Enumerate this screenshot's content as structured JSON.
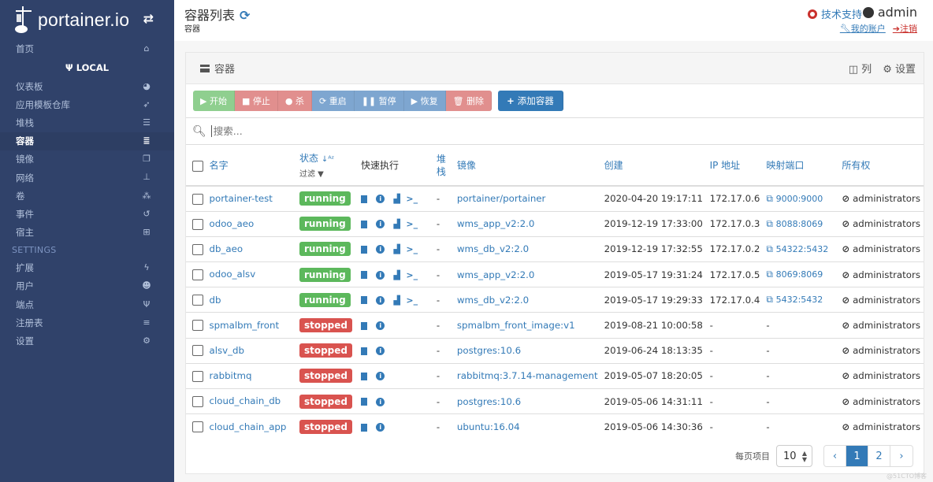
{
  "sidebar": {
    "brand": "portainer.io",
    "home": "首页",
    "endpoint": "LOCAL",
    "items": [
      {
        "label": "仪表板",
        "icon": "tachometer-icon",
        "glyph": "◕"
      },
      {
        "label": "应用模板仓库",
        "icon": "rocket-icon",
        "glyph": "➶"
      },
      {
        "label": "堆栈",
        "icon": "list-icon",
        "glyph": "☰"
      },
      {
        "label": "容器",
        "icon": "server-icon",
        "glyph": "≣",
        "active": true
      },
      {
        "label": "镜像",
        "icon": "clone-icon",
        "glyph": "❐"
      },
      {
        "label": "网络",
        "icon": "sitemap-icon",
        "glyph": "⊥"
      },
      {
        "label": "卷",
        "icon": "cubes-icon",
        "glyph": "⁂"
      },
      {
        "label": "事件",
        "icon": "history-icon",
        "glyph": "↺"
      },
      {
        "label": "宿主",
        "icon": "th-icon",
        "glyph": "⊞"
      }
    ],
    "settings_title": "SETTINGS",
    "settings_items": [
      {
        "label": "扩展",
        "icon": "bolt-icon",
        "glyph": "ϟ"
      },
      {
        "label": "用户",
        "icon": "users-icon",
        "glyph": "☻"
      },
      {
        "label": "端点",
        "icon": "plug-icon",
        "glyph": "Ψ"
      },
      {
        "label": "注册表",
        "icon": "database-icon",
        "glyph": "≡"
      },
      {
        "label": "设置",
        "icon": "cogs-icon",
        "glyph": "⚙"
      }
    ]
  },
  "header": {
    "title": "容器列表",
    "breadcrumb": "容器",
    "support": "技术支持",
    "username": "admin",
    "my_account": "我的账户",
    "logout": "注销"
  },
  "panel": {
    "title": "容器",
    "columns_label": "列",
    "settings_label": "设置",
    "actions": {
      "start": "开始",
      "stop": "停止",
      "kill": "杀",
      "restart": "重启",
      "pause": "暂停",
      "resume": "恢复",
      "remove": "删除",
      "add": "添加容器"
    },
    "search_placeholder": "搜索..."
  },
  "table": {
    "headers": {
      "name": "名字",
      "state": "状态",
      "filter": "过滤",
      "quick_actions": "快速执行",
      "stack": "堆栈",
      "image": "镜像",
      "created": "创建",
      "ip": "IP 地址",
      "ports": "映射端口",
      "ownership": "所有权"
    },
    "rows": [
      {
        "name": "portainer-test",
        "state": "running",
        "stack": "-",
        "image": "portainer/portainer",
        "created": "2020-04-20 19:17:11",
        "ip": "172.17.0.6",
        "ports": "9000:9000",
        "ownership": "administrators"
      },
      {
        "name": "odoo_aeo",
        "state": "running",
        "stack": "-",
        "image": "wms_app_v2:2.0",
        "created": "2019-12-19 17:33:00",
        "ip": "172.17.0.3",
        "ports": "8088:8069",
        "ownership": "administrators"
      },
      {
        "name": "db_aeo",
        "state": "running",
        "stack": "-",
        "image": "wms_db_v2:2.0",
        "created": "2019-12-19 17:32:55",
        "ip": "172.17.0.2",
        "ports": "54322:5432",
        "ownership": "administrators"
      },
      {
        "name": "odoo_alsv",
        "state": "running",
        "stack": "-",
        "image": "wms_app_v2:2.0",
        "created": "2019-05-17 19:31:24",
        "ip": "172.17.0.5",
        "ports": "8069:8069",
        "ownership": "administrators"
      },
      {
        "name": "db",
        "state": "running",
        "stack": "-",
        "image": "wms_db_v2:2.0",
        "created": "2019-05-17 19:29:33",
        "ip": "172.17.0.4",
        "ports": "5432:5432",
        "ownership": "administrators"
      },
      {
        "name": "spmalbm_front",
        "state": "stopped",
        "stack": "-",
        "image": "spmalbm_front_image:v1",
        "created": "2019-08-21 10:00:58",
        "ip": "-",
        "ports": "-",
        "ownership": "administrators"
      },
      {
        "name": "alsv_db",
        "state": "stopped",
        "stack": "-",
        "image": "postgres:10.6",
        "created": "2019-06-24 18:13:35",
        "ip": "-",
        "ports": "-",
        "ownership": "administrators"
      },
      {
        "name": "rabbitmq",
        "state": "stopped",
        "stack": "-",
        "image": "rabbitmq:3.7.14-management",
        "created": "2019-05-07 18:20:05",
        "ip": "-",
        "ports": "-",
        "ownership": "administrators"
      },
      {
        "name": "cloud_chain_db",
        "state": "stopped",
        "stack": "-",
        "image": "postgres:10.6",
        "created": "2019-05-06 14:31:11",
        "ip": "-",
        "ports": "-",
        "ownership": "administrators"
      },
      {
        "name": "cloud_chain_app",
        "state": "stopped",
        "stack": "-",
        "image": "ubuntu:16.04",
        "created": "2019-05-06 14:30:36",
        "ip": "-",
        "ports": "-",
        "ownership": "administrators"
      }
    ]
  },
  "pagination": {
    "per_page_label": "每页项目",
    "per_page_value": "10",
    "pages": [
      "1",
      "2"
    ],
    "current_page": "1",
    "prev": "‹",
    "next": "›"
  },
  "watermark": "@51CTO博客",
  "colors": {
    "sidebar_bg": "#30426a",
    "primary": "#337ab7",
    "running": "#5cb85c",
    "stopped": "#d9534f"
  }
}
